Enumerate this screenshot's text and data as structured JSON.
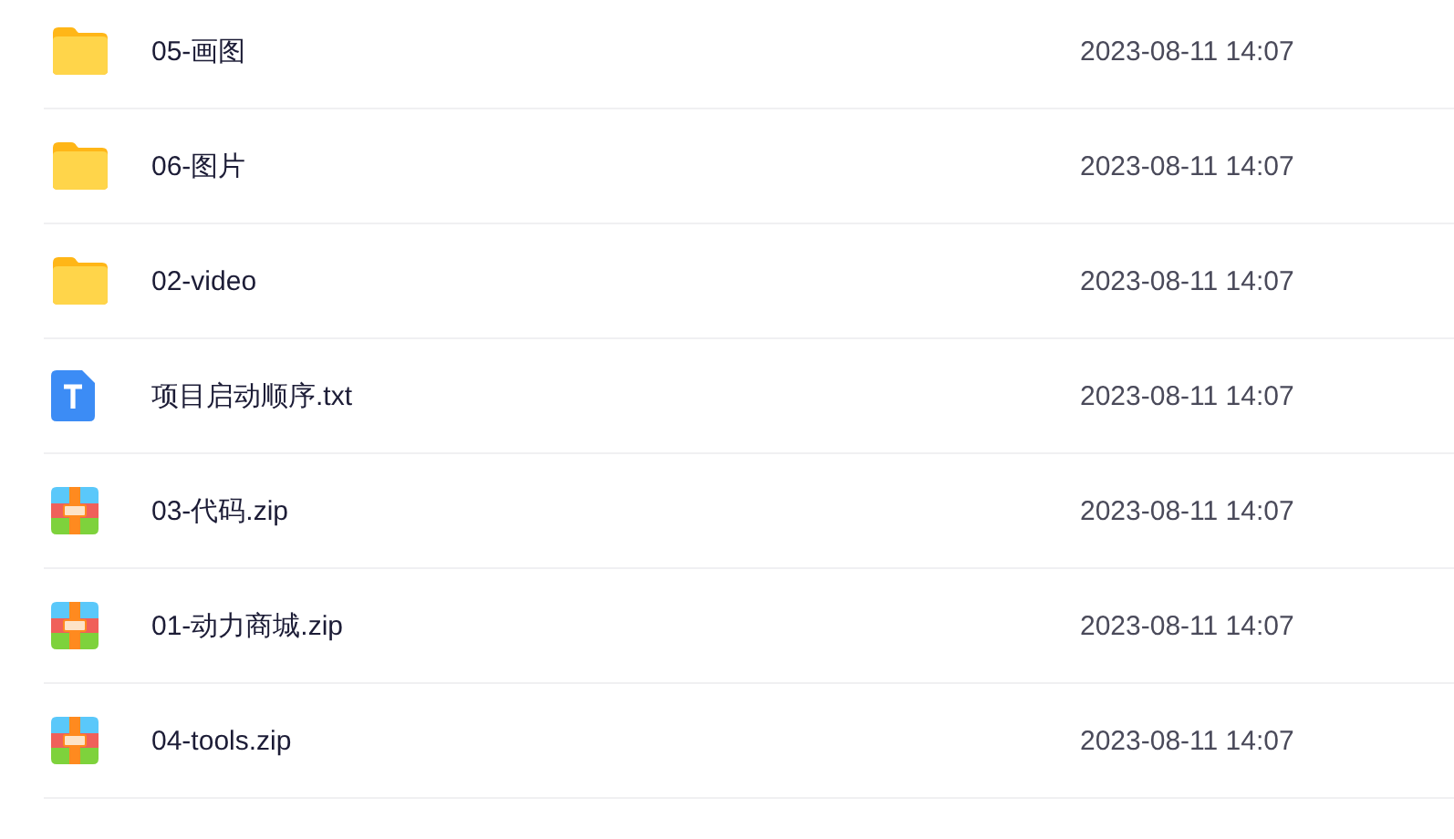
{
  "files": [
    {
      "kind": "folder",
      "name": "05-画图",
      "modified": "2023-08-11 14:07"
    },
    {
      "kind": "folder",
      "name": "06-图片",
      "modified": "2023-08-11 14:07"
    },
    {
      "kind": "folder",
      "name": "02-video",
      "modified": "2023-08-11 14:07"
    },
    {
      "kind": "text",
      "name": "项目启动顺序.txt",
      "modified": "2023-08-11 14:07"
    },
    {
      "kind": "archive",
      "name": "03-代码.zip",
      "modified": "2023-08-11 14:07"
    },
    {
      "kind": "archive",
      "name": "01-动力商城.zip",
      "modified": "2023-08-11 14:07"
    },
    {
      "kind": "archive",
      "name": "04-tools.zip",
      "modified": "2023-08-11 14:07"
    }
  ]
}
